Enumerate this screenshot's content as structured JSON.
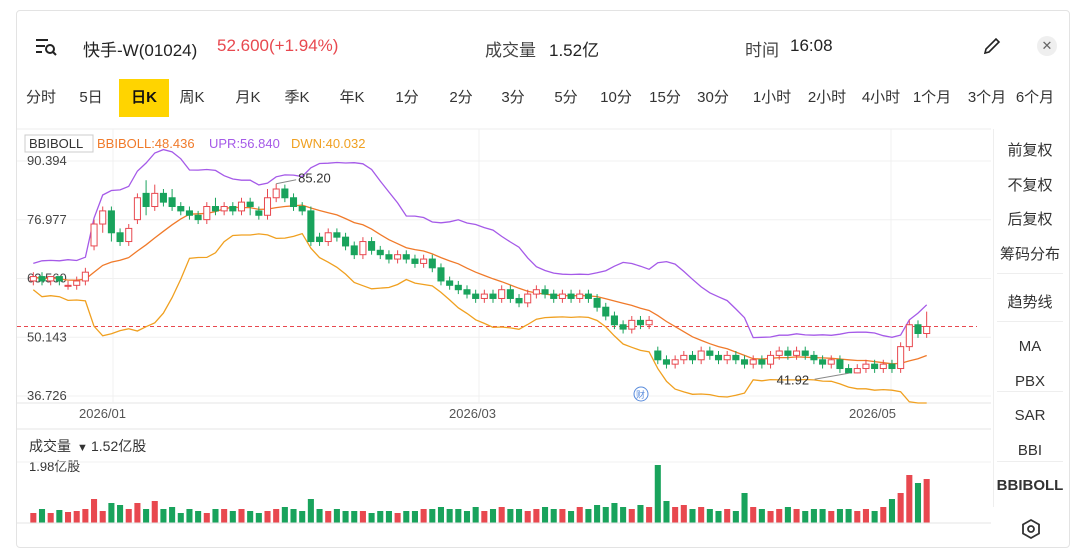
{
  "header": {
    "title": "快手-W(01024)",
    "price": "52.600(+1.94%)",
    "volume_label": "成交量",
    "volume_value": "1.52亿",
    "time_label": "时间",
    "time_value": "16:08",
    "close_icon": "close-icon",
    "edit_icon": "pencil-icon",
    "menu_icon": "search-list-icon"
  },
  "tabs": [
    "分时",
    "5日",
    "日K",
    "周K",
    "月K",
    "季K",
    "年K",
    "1分",
    "2分",
    "3分",
    "5分",
    "10分",
    "15分",
    "30分",
    "1小时",
    "2小时",
    "4小时",
    "1个月",
    "3个月",
    "6个月"
  ],
  "active_tab": "日K",
  "indicator": {
    "name": "BBIBOLL",
    "mid": "BBIBOLL:48.436",
    "upr": "UPR:56.840",
    "dwn": "DWN:40.032"
  },
  "price_axis": [
    "90.394",
    "76.977",
    "63.560",
    "50.143",
    "36.726"
  ],
  "date_axis": [
    "2026/01",
    "2026/03",
    "2026/05"
  ],
  "annotations": {
    "high": "85.20",
    "low": "41.92",
    "marker": "财"
  },
  "volume_panel": {
    "label": "成交量",
    "value": "1.52亿股",
    "max_label": "1.98亿股"
  },
  "side_menu": [
    "前复权",
    "不复权",
    "后复权",
    "筹码分布",
    "趋势线",
    "MA",
    "PBX",
    "SAR",
    "BBI",
    "BBIBOLL"
  ],
  "colors": {
    "up": "#e8484f",
    "down": "#19a35c",
    "mid_line": "#f07a2a",
    "upr_line": "#a55ae8",
    "dwn_line": "#f0a020",
    "active_tab": "#ffd400",
    "ref_line": "#e8484f"
  },
  "chart_data": {
    "type": "candlestick",
    "ylim": [
      36.726,
      90.394
    ],
    "volume_max": "1.98亿股",
    "candles": [
      [
        1,
        63,
        64,
        62,
        65
      ],
      [
        2,
        64,
        63,
        62,
        65
      ],
      [
        3,
        63,
        64,
        62,
        64
      ],
      [
        4,
        64,
        63,
        62,
        64
      ],
      [
        5,
        62,
        62,
        61,
        63
      ],
      [
        6,
        62,
        63,
        61,
        64
      ],
      [
        7,
        63,
        65,
        62,
        66
      ],
      [
        8,
        71,
        76,
        70,
        77
      ],
      [
        9,
        76,
        79,
        74,
        80
      ],
      [
        10,
        79,
        74,
        72,
        80
      ],
      [
        11,
        74,
        72,
        71,
        75
      ],
      [
        12,
        72,
        75,
        71,
        76
      ],
      [
        13,
        77,
        82,
        76,
        83
      ],
      [
        14,
        83,
        80,
        78,
        86
      ],
      [
        15,
        80,
        83,
        79,
        85
      ],
      [
        16,
        83,
        81,
        80,
        84
      ],
      [
        17,
        82,
        80,
        79,
        84
      ],
      [
        18,
        80,
        79,
        78,
        81
      ],
      [
        19,
        79,
        78,
        77,
        80
      ],
      [
        20,
        78,
        77,
        76,
        79
      ],
      [
        21,
        77,
        80,
        76,
        81
      ],
      [
        22,
        80,
        79,
        78,
        82
      ],
      [
        23,
        79,
        80,
        78,
        81
      ],
      [
        24,
        80,
        79,
        78,
        81
      ],
      [
        25,
        79,
        81,
        78,
        82
      ],
      [
        26,
        81,
        80,
        78,
        82
      ],
      [
        27,
        79,
        78,
        77,
        80
      ],
      [
        28,
        78,
        82,
        77,
        84
      ],
      [
        29,
        82,
        84,
        81,
        85.2
      ],
      [
        30,
        84,
        82,
        81,
        85
      ],
      [
        31,
        82,
        80,
        79,
        83
      ],
      [
        32,
        80,
        79,
        78,
        81
      ],
      [
        33,
        79,
        72,
        71,
        80
      ],
      [
        34,
        73,
        72,
        71,
        74
      ],
      [
        35,
        72,
        74,
        71,
        75
      ],
      [
        36,
        74,
        73,
        72,
        75
      ],
      [
        37,
        73,
        71,
        70,
        74
      ],
      [
        38,
        71,
        69,
        68,
        72
      ],
      [
        39,
        69,
        72,
        68,
        73
      ],
      [
        40,
        72,
        70,
        69,
        73
      ],
      [
        41,
        70,
        69,
        68,
        71
      ],
      [
        42,
        69,
        68,
        67,
        70
      ],
      [
        43,
        68,
        69,
        67,
        70
      ],
      [
        44,
        69,
        68,
        67,
        70
      ],
      [
        45,
        68,
        67,
        66,
        69
      ],
      [
        46,
        67,
        68,
        66,
        69
      ],
      [
        47,
        68,
        66,
        65,
        69
      ],
      [
        48,
        66,
        63,
        62,
        67
      ],
      [
        49,
        63,
        62,
        61,
        64
      ],
      [
        50,
        62,
        61,
        60,
        63
      ],
      [
        51,
        61,
        60,
        59,
        62
      ],
      [
        52,
        60,
        59,
        58,
        61
      ],
      [
        53,
        59,
        60,
        58,
        61
      ],
      [
        54,
        60,
        59,
        58,
        61
      ],
      [
        55,
        59,
        61,
        58,
        62
      ],
      [
        56,
        61,
        59,
        58,
        62
      ],
      [
        57,
        59,
        58,
        57,
        60
      ],
      [
        58,
        58,
        60,
        57,
        61
      ],
      [
        59,
        60,
        61,
        59,
        62
      ],
      [
        60,
        61,
        60,
        59,
        62
      ],
      [
        61,
        60,
        59,
        58,
        61
      ],
      [
        62,
        59,
        60,
        58,
        61
      ],
      [
        63,
        60,
        59,
        58,
        61
      ],
      [
        64,
        59,
        60,
        58,
        61
      ],
      [
        65,
        60,
        59,
        58,
        61
      ],
      [
        66,
        59,
        57,
        56,
        60
      ],
      [
        67,
        57,
        55,
        54,
        58
      ],
      [
        68,
        55,
        53,
        52,
        56
      ],
      [
        69,
        53,
        52,
        51,
        54
      ],
      [
        70,
        52,
        54,
        51,
        55
      ],
      [
        71,
        54,
        53,
        52,
        55
      ],
      [
        72,
        53,
        54,
        52,
        55
      ],
      [
        73,
        47,
        45,
        44,
        48
      ],
      [
        74,
        45,
        44,
        43,
        46
      ],
      [
        75,
        44,
        45,
        43,
        46
      ],
      [
        76,
        45,
        46,
        44,
        47
      ],
      [
        77,
        46,
        45,
        44,
        47
      ],
      [
        78,
        45,
        47,
        44,
        48
      ],
      [
        79,
        47,
        46,
        45,
        48
      ],
      [
        80,
        46,
        45,
        44,
        47
      ],
      [
        81,
        45,
        46,
        44,
        47
      ],
      [
        82,
        46,
        45,
        44,
        47
      ],
      [
        83,
        45,
        44,
        43,
        46
      ],
      [
        84,
        44,
        45,
        43,
        46
      ],
      [
        85,
        45,
        44,
        43,
        46
      ],
      [
        86,
        44,
        46,
        43,
        47
      ],
      [
        87,
        46,
        47,
        45,
        48
      ],
      [
        88,
        47,
        46,
        45,
        48
      ],
      [
        89,
        46,
        47,
        45,
        48
      ],
      [
        90,
        47,
        46,
        45,
        48
      ],
      [
        91,
        46,
        45,
        44,
        47
      ],
      [
        92,
        45,
        44,
        43,
        46
      ],
      [
        93,
        44,
        45,
        43,
        46
      ],
      [
        94,
        45,
        43,
        42,
        46
      ],
      [
        95,
        43,
        42,
        41.92,
        44
      ],
      [
        96,
        42,
        43,
        41.92,
        44
      ],
      [
        97,
        43,
        44,
        42,
        45
      ],
      [
        98,
        44,
        43,
        42,
        45
      ],
      [
        99,
        43,
        44,
        42,
        45
      ],
      [
        100,
        44,
        43,
        42,
        45
      ],
      [
        101,
        43,
        48,
        42,
        49
      ],
      [
        102,
        48,
        53,
        47,
        54
      ],
      [
        103,
        53,
        51,
        50,
        54
      ],
      [
        104,
        51,
        52.6,
        50,
        56
      ]
    ],
    "volume": [
      10,
      14,
      10,
      13,
      11,
      12,
      14,
      24,
      12,
      20,
      18,
      14,
      20,
      14,
      22,
      14,
      16,
      10,
      14,
      12,
      10,
      14,
      14,
      12,
      14,
      12,
      10,
      12,
      14,
      16,
      14,
      12,
      24,
      14,
      12,
      14,
      12,
      12,
      12,
      10,
      12,
      12,
      10,
      12,
      12,
      14,
      14,
      16,
      14,
      14,
      12,
      16,
      12,
      14,
      16,
      14,
      14,
      12,
      14,
      16,
      14,
      14,
      12,
      16,
      14,
      18,
      16,
      20,
      16,
      14,
      18,
      16,
      58,
      22,
      16,
      18,
      14,
      16,
      14,
      12,
      14,
      12,
      30,
      16,
      14,
      12,
      14,
      16,
      14,
      12,
      14,
      14,
      12,
      14,
      14,
      12,
      14,
      12,
      16,
      24,
      30,
      48,
      40,
      44
    ]
  }
}
